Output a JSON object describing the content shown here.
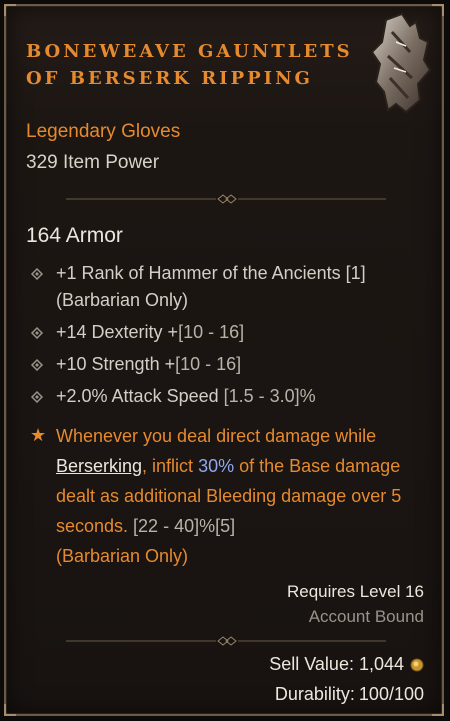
{
  "item": {
    "name": "Boneweave Gauntlets of Berserk Ripping",
    "type": "Legendary Gloves",
    "power": "329 Item Power",
    "image_icon": "gauntlet-icon"
  },
  "stats": {
    "armor": "164 Armor"
  },
  "affixes": [
    {
      "text": "+1 Rank of Hammer of the Ancients [1]",
      "line2": "(Barbarian Only)"
    },
    {
      "text": "+14 Dexterity +",
      "range": "[10 - 16]"
    },
    {
      "text": "+10 Strength +",
      "range": "[10 - 16]"
    },
    {
      "text": "+2.0% Attack Speed ",
      "range": "[1.5 - 3.0]%"
    }
  ],
  "legendary": {
    "part1": "Whenever you deal direct damage while ",
    "keyword": "Berserking",
    "part2": ", inflict ",
    "percent": "30%",
    "part3": " of the Base damage dealt as additional Bleeding damage over 5 seconds. ",
    "range": "[22 - 40]%[5]",
    "class_note": "(Barbarian Only)"
  },
  "requirements": {
    "level": "Requires Level 16",
    "binding": "Account Bound"
  },
  "footer": {
    "sell_label": "Sell Value: 1,044",
    "durability_label": "Durability:",
    "durability_value": "100/100"
  },
  "colors": {
    "legendary": "#e58a2e",
    "text": "#d4cec6",
    "highlight_value": "#8fa8ee",
    "frame": "#6a5a48"
  }
}
